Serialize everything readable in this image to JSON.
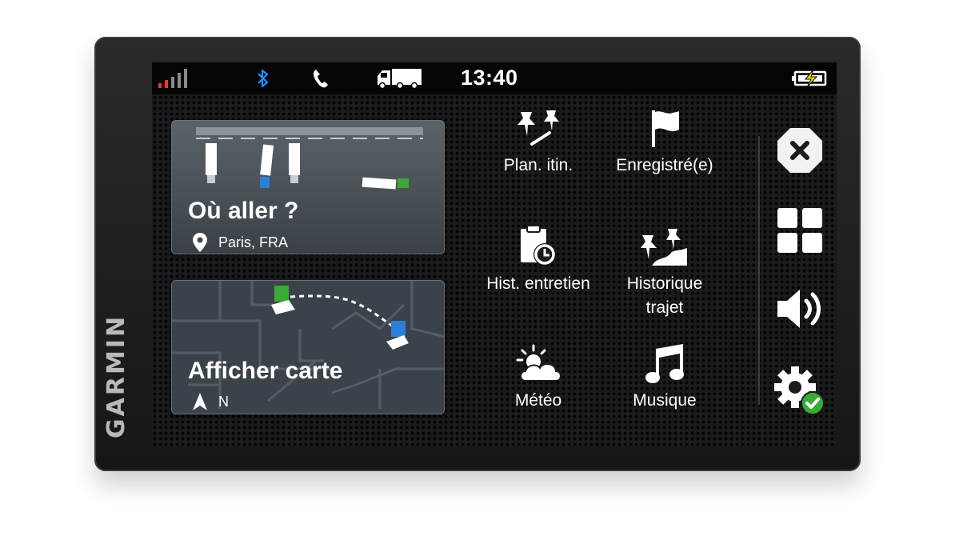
{
  "device": {
    "brand": "GARMIN"
  },
  "status_bar": {
    "time": "13:40",
    "icons": [
      "signal-icon",
      "bluetooth-icon",
      "phone-icon",
      "truck-icon",
      "battery-charging-icon"
    ],
    "colors": {
      "bluetooth": "#1e90ff",
      "charging": "#f2d600"
    }
  },
  "cards": {
    "where_to": {
      "title": "Où aller ?",
      "location": "Paris, FRA"
    },
    "view_map": {
      "title": "Afficher carte",
      "heading": "N"
    }
  },
  "menu": {
    "items": [
      {
        "label": "Plan. itin.",
        "icon": "trip-planner-icon"
      },
      {
        "label": "Enregistré(e)",
        "icon": "flag-icon"
      },
      {
        "label": "Hist. entretien",
        "icon": "service-history-icon"
      },
      {
        "label": "Historique\ntrajet",
        "icon": "trip-history-icon"
      },
      {
        "label": "Météo",
        "icon": "weather-icon"
      },
      {
        "label": "Musique",
        "icon": "music-icon"
      }
    ]
  },
  "sidebar": {
    "buttons": [
      "close-icon",
      "apps-grid-icon",
      "volume-icon",
      "settings-icon"
    ],
    "colors": {
      "settings_badge": "#3aa935"
    }
  }
}
